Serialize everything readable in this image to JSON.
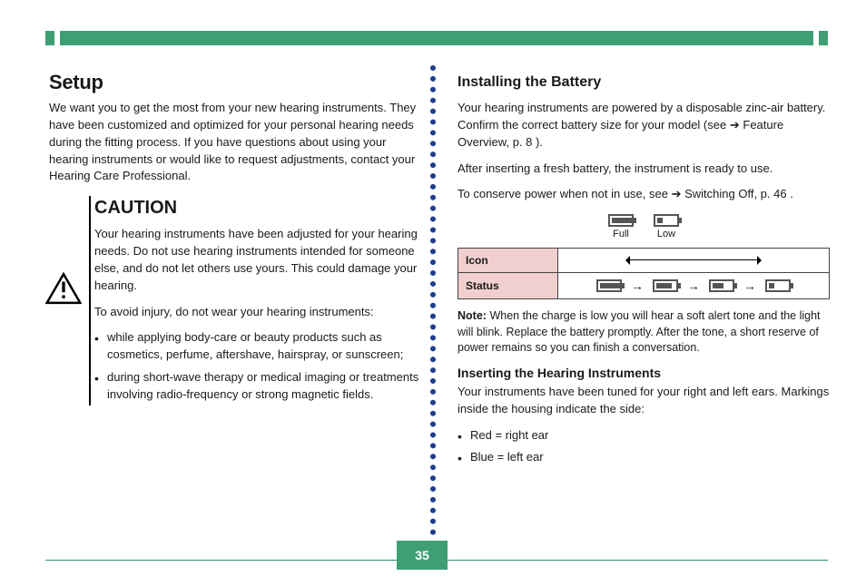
{
  "page_number": "35",
  "left": {
    "title": "Setup",
    "intro": "We want you to get the most from your new hearing instruments. They have been customized and optimized for your personal hearing needs during the fitting process. If you have questions about using your hearing instruments or would like to request adjustments, contact your Hearing Care Professional.",
    "caution_title": "CAUTION",
    "caution_p1": "Your hearing instruments have been adjusted for your hearing needs. Do not use hearing instruments intended for someone else, and do not let others use yours. This could damage your hearing.",
    "caution_p2": "To avoid injury, do not wear your hearing instruments:",
    "caution_items": [
      "while applying body-care or beauty products such as cosmetics, perfume, aftershave, hairspray, or sunscreen;",
      "during short-wave therapy or medical imaging or treatments involving radio-frequency or strong magnetic fields."
    ]
  },
  "right": {
    "install_title": "Installing the Battery",
    "install_p1": "Your hearing instruments are powered by a disposable zinc-air battery. Confirm the correct battery size for your model (see",
    "install_ref_label": "Feature Overview",
    "install_ref_pg": "p. 8",
    "install_p1_tail": ").",
    "install_p2": "After inserting a fresh battery, the instrument is ready to use.",
    "install_p3": "To conserve power when not in use,",
    "install_ref2_label": "Switching Off",
    "install_ref2_pg": "p. 46",
    "install_p3_tail": ".",
    "b_full": "Full",
    "b_low": "Low",
    "t_row1_h": "Icon",
    "t_row2_h": "Status",
    "low_note_label": "Note:",
    "low_note": "When the charge is low you will hear a soft alert tone and the light will blink. Replace the battery promptly. After the tone, a short reserve of power remains so you can finish a conversation.",
    "ins_title": "Inserting the Hearing Instruments",
    "ins_p": "Your instruments have been tuned for your right and left ears. Markings inside the housing indicate the side:",
    "ins_items": [
      "Red = right ear",
      "Blue = left ear"
    ]
  }
}
